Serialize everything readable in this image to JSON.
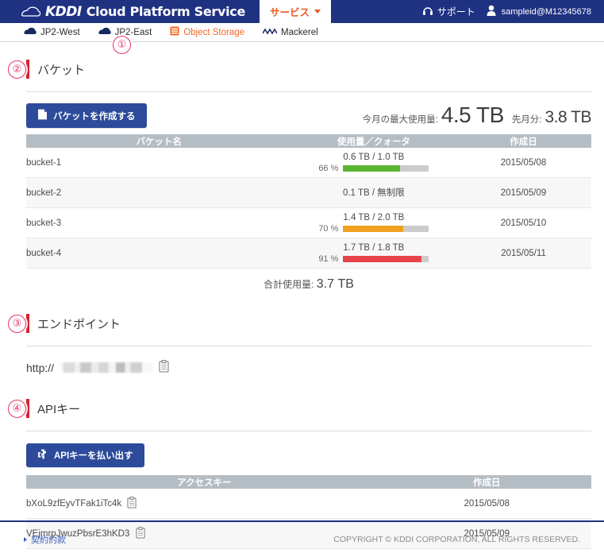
{
  "header": {
    "brand_kddi": "KDDI",
    "brand_rest": "Cloud Platform Service",
    "cloud_icon": "cloud-icon",
    "service_tab": "サービス",
    "service_caret_icon": "chevron-down-icon",
    "support_label": "サポート",
    "support_icon": "headset-icon",
    "user_icon": "user-icon",
    "user_id": "sampleid@M12345678"
  },
  "subnav": {
    "items": [
      {
        "label": "JP2-West",
        "icon": "cloud-icon",
        "active": false
      },
      {
        "label": "JP2-East",
        "icon": "cloud-icon",
        "active": false
      },
      {
        "label": "Object Storage",
        "icon": "storage-icon",
        "active": true
      },
      {
        "label": "Mackerel",
        "icon": "zigzag-icon",
        "active": false
      }
    ]
  },
  "annotations": [
    {
      "label": "①"
    },
    {
      "label": "②"
    },
    {
      "label": "③"
    },
    {
      "label": "④"
    }
  ],
  "bucket_section": {
    "title": "バケット",
    "create_button": "バケットを作成する",
    "create_button_icon": "page-add-icon",
    "summary": {
      "month_label": "今月の最大使用量:",
      "month_value": "4.5 TB",
      "last_month_label": "先月分:",
      "last_month_value": "3.8 TB"
    },
    "columns": [
      "バケット名",
      "使用量／クォータ",
      "作成日"
    ],
    "rows": [
      {
        "name": "bucket-1",
        "usage": "0.6 TB / 1.0 TB",
        "percent_label": "66 %",
        "percent": 66,
        "bar_color": "#5cb531",
        "has_bar": true,
        "created": "2015/05/08"
      },
      {
        "name": "bucket-2",
        "usage": "0.1 TB / 無制限",
        "percent_label": "",
        "percent": 0,
        "bar_color": "",
        "has_bar": false,
        "created": "2015/05/09"
      },
      {
        "name": "bucket-3",
        "usage": "1.4 TB / 2.0 TB",
        "percent_label": "70 %",
        "percent": 70,
        "bar_color": "#f0a01e",
        "has_bar": true,
        "created": "2015/05/10"
      },
      {
        "name": "bucket-4",
        "usage": "1.7 TB / 1.8 TB",
        "percent_label": "91 %",
        "percent": 91,
        "bar_color": "#e8434a",
        "has_bar": true,
        "created": "2015/05/11"
      }
    ],
    "total_label": "合計使用量:",
    "total_value": "3.7 TB"
  },
  "endpoint_section": {
    "title": "エンドポイント",
    "protocol": "http://",
    "host_masked": "",
    "copy_icon": "clipboard-copy-icon"
  },
  "apikey_section": {
    "title": "APIキー",
    "issue_button": "APIキーを払い出す",
    "issue_button_icon": "puzzle-piece-icon",
    "columns": [
      "アクセスキー",
      "作成日"
    ],
    "rows": [
      {
        "key": "bXoL9zfEyvTFak1iTc4k",
        "copy_icon": "clipboard-copy-icon",
        "created": "2015/05/08"
      },
      {
        "key": "VEjmrpJwuzPbsrE3hKD3",
        "copy_icon": "clipboard-copy-icon",
        "created": "2015/05/09"
      }
    ]
  },
  "footer": {
    "terms_link": "契約約款",
    "copyright": "COPYRIGHT © KDDI CORPORATION, ALL RIGHTS RESERVED."
  },
  "colors": {
    "brand_navy": "#1f3282",
    "accent_orange": "#f26722",
    "button_blue": "#2d4b9a",
    "heading_red": "#d9232e",
    "annotation_pink": "#e8336d"
  }
}
